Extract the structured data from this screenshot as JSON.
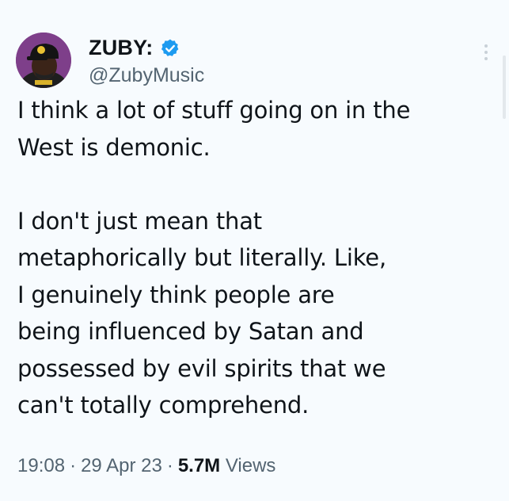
{
  "author": {
    "display_name": "ZUBY:",
    "handle": "@ZubyMusic",
    "verified": true,
    "verified_color": "#1d9bf0",
    "avatar_bg": "#7e3f8a"
  },
  "tweet": {
    "line1": "I think a lot of stuff going on in the",
    "line2": "West is demonic.",
    "line3": "I don't just mean that",
    "line4": "metaphorically but literally. Like,",
    "line5": "I genuinely think people are",
    "line6": "being influenced by Satan and",
    "line7": "possessed by evil spirits that we",
    "line8": "can't totally comprehend."
  },
  "meta": {
    "time": "19:08",
    "separator": "·",
    "date": "29 Apr 23",
    "views_count": "5.7M",
    "views_label": "Views"
  },
  "icons": {
    "more": "more-vertical-icon",
    "verified": "verified-badge-icon"
  }
}
